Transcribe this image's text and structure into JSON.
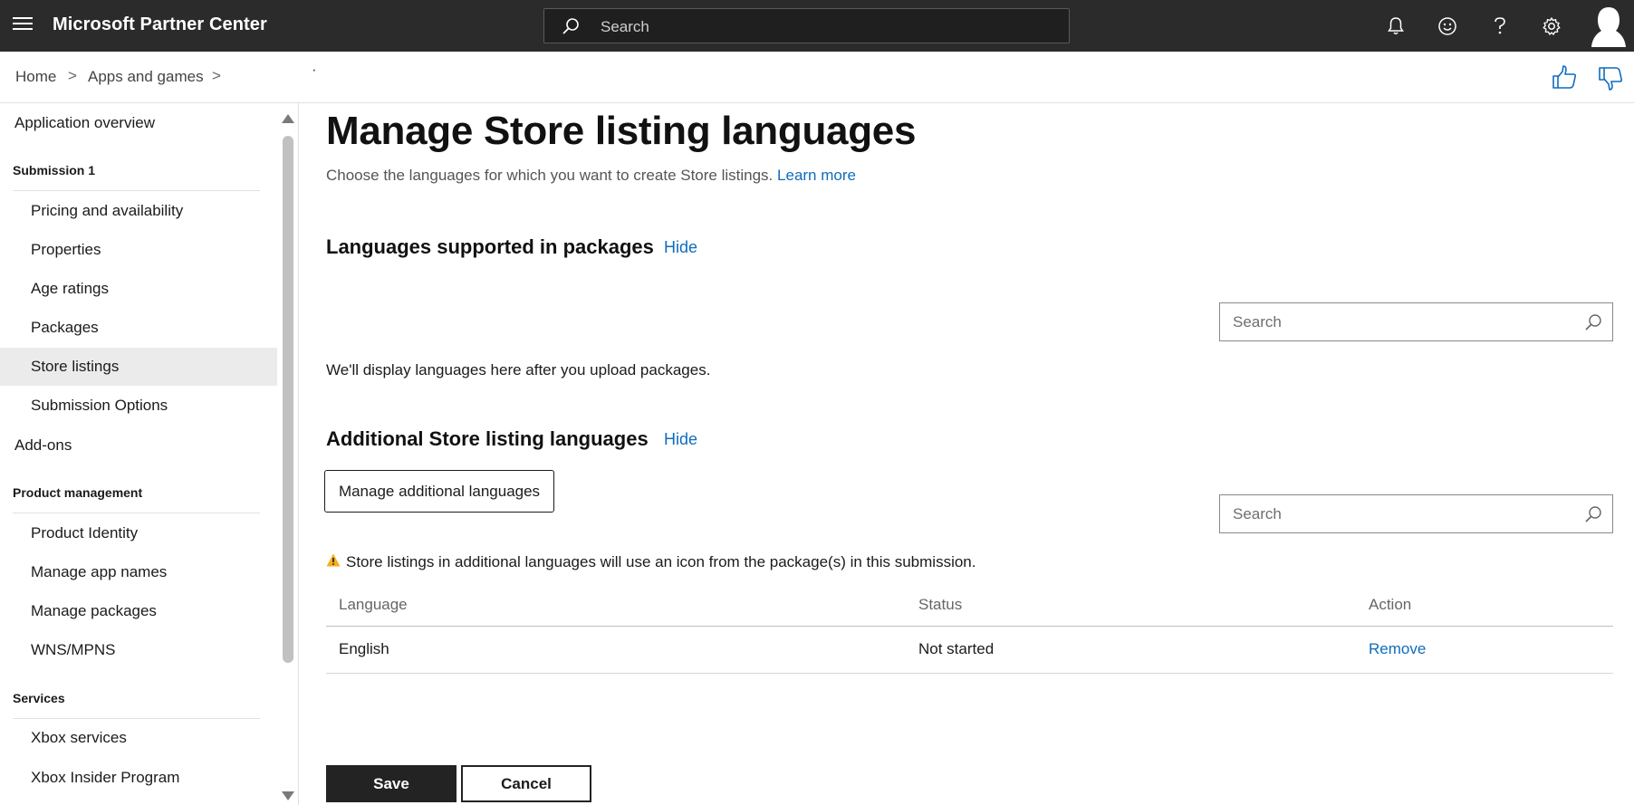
{
  "header": {
    "app_title": "Microsoft Partner Center",
    "search_placeholder": "Search",
    "icons": [
      "menu-icon",
      "search-icon",
      "bell-icon",
      "smiley-icon",
      "help-icon",
      "gear-icon",
      "avatar-icon"
    ]
  },
  "breadcrumb": {
    "items": [
      "Home",
      "Apps and games"
    ],
    "separator": ">",
    "trailing": "·"
  },
  "feedback_icons": [
    "thumbs-up-icon",
    "thumbs-down-icon"
  ],
  "sidebar": {
    "app_overview": "Application overview",
    "sections": [
      {
        "title": "Submission 1",
        "items": [
          "Pricing and availability",
          "Properties",
          "Age ratings",
          "Packages",
          "Store listings",
          "Submission Options"
        ]
      },
      {
        "title": "Product management",
        "items": [
          "Product Identity",
          "Manage app names",
          "Manage packages",
          "WNS/MPNS"
        ]
      },
      {
        "title": "Services",
        "items": [
          "Xbox services",
          "Xbox Insider Program"
        ]
      }
    ],
    "addons": "Add-ons",
    "active_item": "Store listings"
  },
  "main": {
    "title": "Manage Store listing languages",
    "description": "Choose the languages for which you want to create Store listings.",
    "learn_more": "Learn more",
    "packages_section": {
      "title": "Languages supported in packages",
      "toggle": "Hide",
      "search_placeholder": "Search",
      "empty_message": "We'll display languages here after you upload packages."
    },
    "additional_section": {
      "title": "Additional Store listing languages",
      "toggle": "Hide",
      "manage_button": "Manage additional languages",
      "search_placeholder": "Search",
      "warning": "Store listings in additional languages will use an icon from the package(s) in this submission.",
      "table": {
        "columns": [
          "Language",
          "Status",
          "Action"
        ],
        "rows": [
          {
            "language": "English",
            "status": "Not started",
            "action": "Remove"
          }
        ]
      }
    },
    "save_button": "Save",
    "cancel_button": "Cancel"
  },
  "colors": {
    "topbar": "#2b2b2b",
    "link": "#0f6cbd",
    "primary_button": "#232323",
    "warning": "#f2b01e",
    "active_nav": "#ebebeb"
  }
}
